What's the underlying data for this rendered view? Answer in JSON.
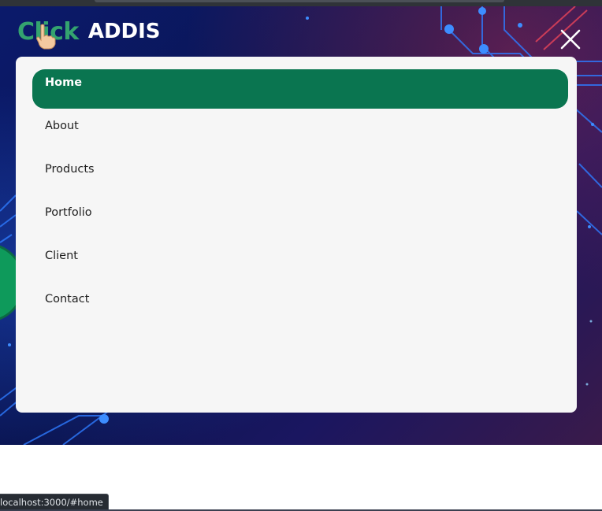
{
  "logo": {
    "brand_part1": "Click",
    "brand_part2": "ADDIS",
    "accent_color": "#34a36f",
    "hand_icon": "pointing-hand-icon"
  },
  "header": {
    "close_icon": "close-icon",
    "close_color": "#ffffff"
  },
  "menu": {
    "items": [
      {
        "label": "Home",
        "active": true
      },
      {
        "label": "About",
        "active": false
      },
      {
        "label": "Products",
        "active": false
      },
      {
        "label": "Portfolio",
        "active": false
      },
      {
        "label": "Client",
        "active": false
      },
      {
        "label": "Contact",
        "active": false
      }
    ],
    "active_color": "#0a7550",
    "panel_color": "#f6f6f6"
  },
  "status_bar": {
    "url": "localhost:3000/#home"
  }
}
